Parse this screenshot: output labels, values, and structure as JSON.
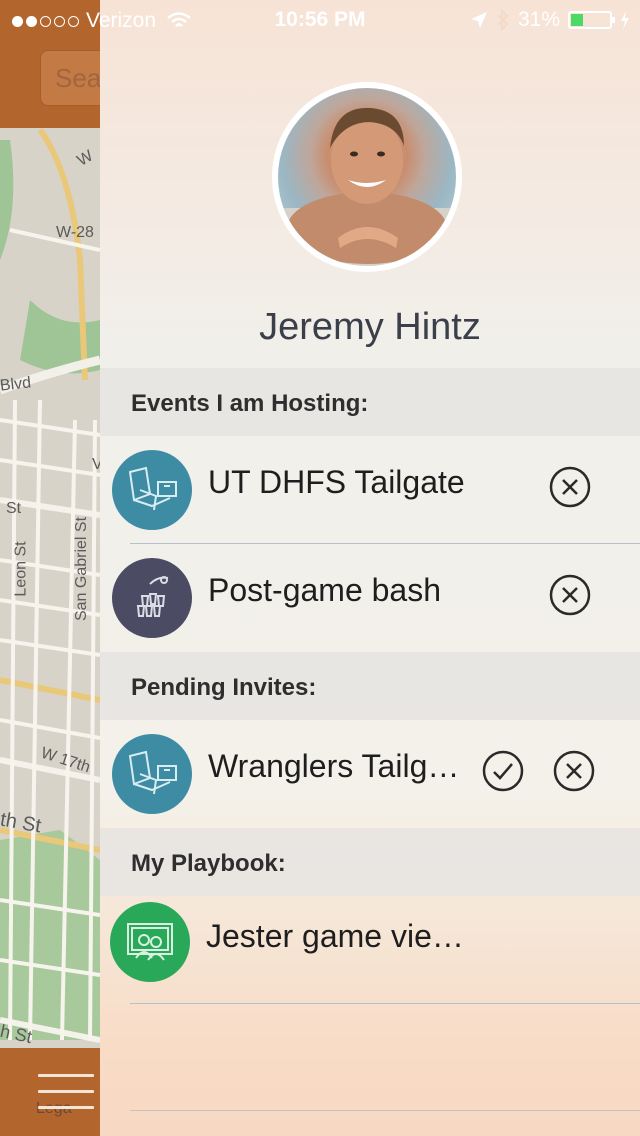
{
  "status_bar": {
    "carrier": "Verizon",
    "time": "10:56 PM",
    "battery": "31%",
    "battery_level": 0.31
  },
  "map": {
    "search_placeholder": "Sea",
    "street_labels": [
      "W",
      "W-28",
      "Blvd",
      "V",
      "St",
      "Leon St",
      "San Gabriel St",
      "W 17th",
      "th St",
      "h St",
      "Lega"
    ]
  },
  "profile": {
    "name": "Jeremy Hintz"
  },
  "sections": {
    "hosting": "Events I am Hosting:",
    "pending": "Pending Invites:",
    "playbook": "My Playbook:"
  },
  "hosting_events": [
    {
      "title": "UT DHFS Tailgate",
      "icon": "tailgate-chair-icon"
    },
    {
      "title": "Post-game bash",
      "icon": "party-cups-icon"
    }
  ],
  "pending_invites": [
    {
      "title": "Wranglers Tailg…",
      "icon": "tailgate-chair-icon"
    }
  ],
  "playbook": [
    {
      "title": "Jester game vie…",
      "icon": "tv-viewing-icon"
    }
  ],
  "colors": {
    "teal": "#3d8ca3",
    "slate": "#4b4c63",
    "green": "#2aa85a",
    "map_bar": "#b2662d"
  }
}
